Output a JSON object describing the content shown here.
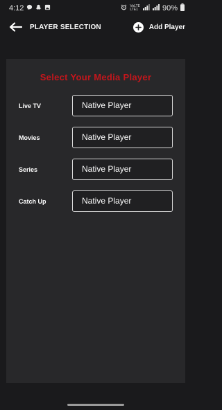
{
  "status_bar": {
    "time": "4:12",
    "battery": "90%",
    "volte_label": "VoLTE",
    "lte_label": "LTE1"
  },
  "header": {
    "title": "PLAYER SELECTION",
    "add_player_label": "Add Player",
    "back_icon": "arrow-left-icon",
    "add_icon": "plus-circle-icon"
  },
  "panel": {
    "title": "Select Your Media Player",
    "title_color": "#c4161c",
    "rows": [
      {
        "label": "Live TV",
        "value": "Native Player"
      },
      {
        "label": "Movies",
        "value": "Native Player"
      },
      {
        "label": "Series",
        "value": "Native Player"
      },
      {
        "label": "Catch Up",
        "value": "Native Player"
      }
    ]
  }
}
